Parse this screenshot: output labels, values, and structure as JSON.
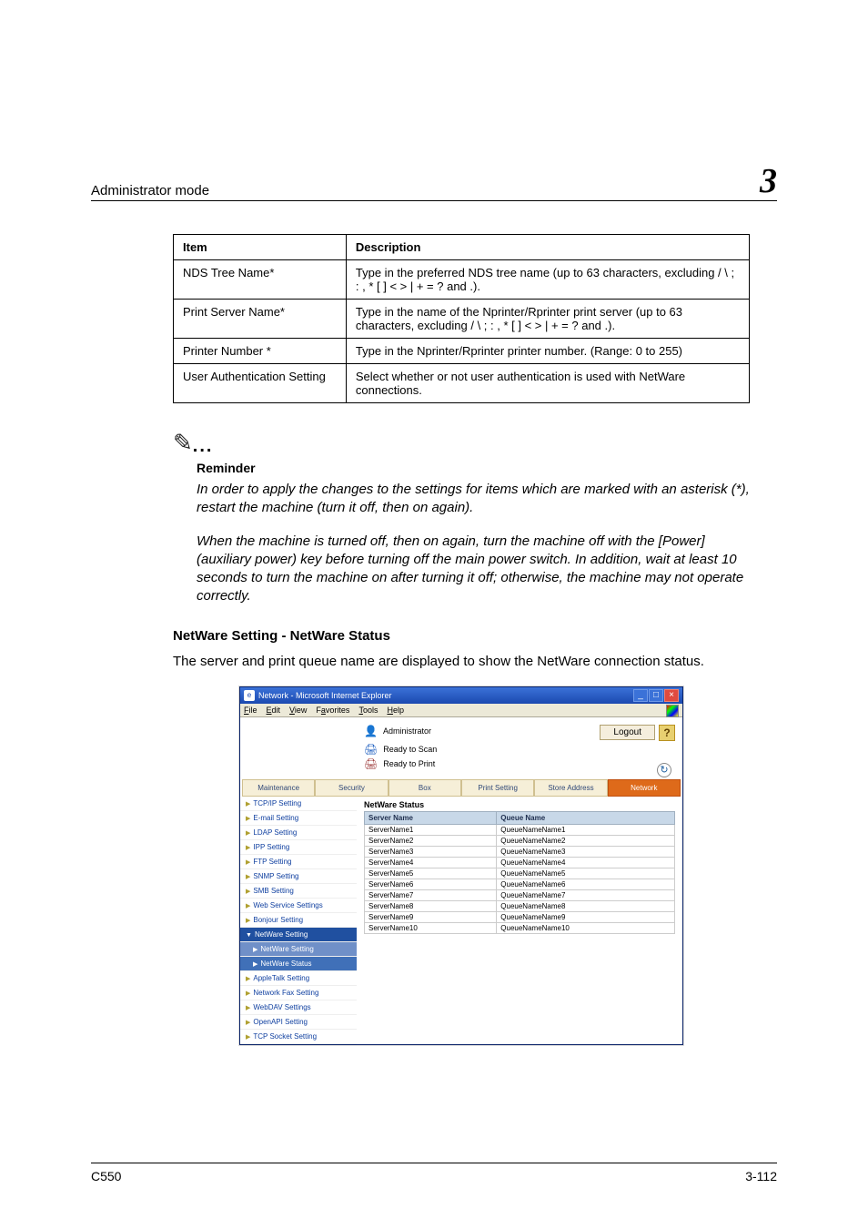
{
  "header": {
    "title": "Administrator mode",
    "chapter": "3"
  },
  "table": {
    "head_item": "Item",
    "head_desc": "Description",
    "rows": [
      {
        "item": "NDS Tree Name*",
        "desc": "Type in the preferred NDS tree name (up to 63 characters, excluding / \\ ; : , * [ ] < > | + = ? and .)."
      },
      {
        "item": "Print Server Name*",
        "desc": "Type in the name of the Nprinter/Rprinter print server (up to 63 characters, excluding / \\ ; : , * [ ] < > | + = ? and .)."
      },
      {
        "item": "Printer Number *",
        "desc": "Type in the Nprinter/Rprinter printer number. (Range: 0 to 255)"
      },
      {
        "item": "User Authentication Setting",
        "desc": "Select whether or not user authentication is used with NetWare connections."
      }
    ]
  },
  "reminder": {
    "label": "Reminder",
    "p1": "In order to apply the changes to the settings for items which are marked with an asterisk (*), restart the machine (turn it off, then on again).",
    "p2": "When the machine is turned off, then on again, turn the machine off with the [Power] (auxiliary power) key before turning off the main power switch. In addition, wait at least 10 seconds to turn the machine on after turning it off; otherwise, the machine may not operate correctly."
  },
  "section": {
    "title": "NetWare Setting - NetWare Status",
    "desc": "The server and print queue name are displayed to show the NetWare connection status."
  },
  "ie": {
    "title": "Network - Microsoft Internet Explorer",
    "menu": [
      "File",
      "Edit",
      "View",
      "Favorites",
      "Tools",
      "Help"
    ],
    "admin": "Administrator",
    "status1": "Ready to Scan",
    "status2": "Ready to Print",
    "logout": "Logout",
    "tabs": [
      "Maintenance",
      "Security",
      "Box",
      "Print Setting",
      "Store Address",
      "Network"
    ],
    "sidebar": [
      "TCP/IP Setting",
      "E-mail Setting",
      "LDAP Setting",
      "IPP Setting",
      "FTP Setting",
      "SNMP Setting",
      "SMB Setting",
      "Web Service Settings",
      "Bonjour Setting",
      "NetWare Setting",
      "NetWare Setting",
      "NetWare Status",
      "AppleTalk Setting",
      "Network Fax Setting",
      "WebDAV Settings",
      "OpenAPI Setting",
      "TCP Socket Setting"
    ],
    "pane_title": "NetWare Status",
    "col1": "Server Name",
    "col2": "Queue Name",
    "rows": [
      [
        "ServerName1",
        "QueueNameName1"
      ],
      [
        "ServerName2",
        "QueueNameName2"
      ],
      [
        "ServerName3",
        "QueueNameName3"
      ],
      [
        "ServerName4",
        "QueueNameName4"
      ],
      [
        "ServerName5",
        "QueueNameName5"
      ],
      [
        "ServerName6",
        "QueueNameName6"
      ],
      [
        "ServerName7",
        "QueueNameName7"
      ],
      [
        "ServerName8",
        "QueueNameName8"
      ],
      [
        "ServerName9",
        "QueueNameName9"
      ],
      [
        "ServerName10",
        "QueueNameName10"
      ]
    ]
  },
  "footer": {
    "left": "C550",
    "right": "3-112"
  }
}
